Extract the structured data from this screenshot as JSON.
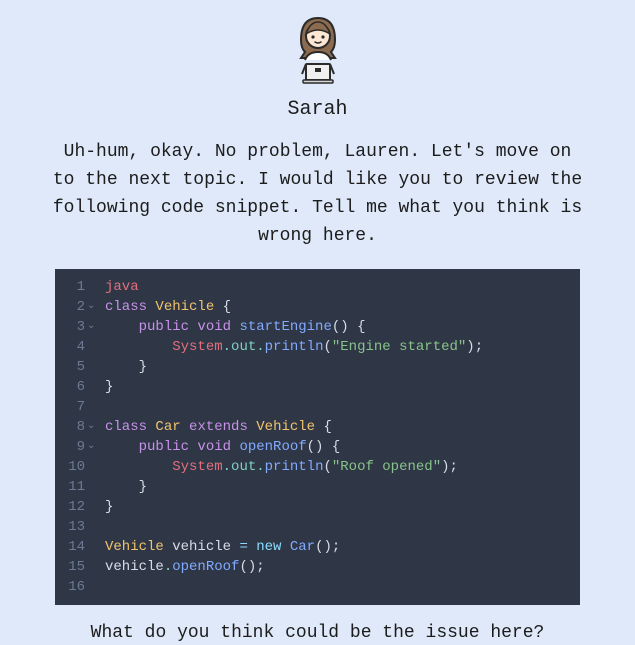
{
  "speaker": {
    "name": "Sarah"
  },
  "speech": "Uh-hum, okay. No problem, Lauren. Let's move on to the next topic. I would like you to review the following code snippet. Tell me what you think is wrong here.",
  "followup": "What do you think could be the issue here?",
  "code": {
    "language": "java",
    "lines": [
      {
        "n": 1,
        "fold": false,
        "tokens": [
          [
            "lang",
            "java"
          ]
        ]
      },
      {
        "n": 2,
        "fold": true,
        "tokens": [
          [
            "kw",
            "class "
          ],
          [
            "type",
            "Vehicle"
          ],
          [
            "punc",
            " {"
          ]
        ]
      },
      {
        "n": 3,
        "fold": true,
        "tokens": [
          [
            "plain",
            "    "
          ],
          [
            "kw",
            "public void "
          ],
          [
            "fn",
            "startEngine"
          ],
          [
            "punc",
            "() {"
          ]
        ]
      },
      {
        "n": 4,
        "fold": false,
        "tokens": [
          [
            "plain",
            "        "
          ],
          [
            "obj",
            "System"
          ],
          [
            "dot",
            ".out."
          ],
          [
            "fn",
            "println"
          ],
          [
            "punc",
            "("
          ],
          [
            "str",
            "\"Engine started\""
          ],
          [
            "punc",
            ");"
          ]
        ]
      },
      {
        "n": 5,
        "fold": false,
        "tokens": [
          [
            "plain",
            "    "
          ],
          [
            "punc",
            "}"
          ]
        ]
      },
      {
        "n": 6,
        "fold": false,
        "tokens": [
          [
            "punc",
            "}"
          ]
        ]
      },
      {
        "n": 7,
        "fold": false,
        "tokens": []
      },
      {
        "n": 8,
        "fold": true,
        "tokens": [
          [
            "kw",
            "class "
          ],
          [
            "type",
            "Car"
          ],
          [
            "kw",
            " extends "
          ],
          [
            "type",
            "Vehicle"
          ],
          [
            "punc",
            " {"
          ]
        ]
      },
      {
        "n": 9,
        "fold": true,
        "tokens": [
          [
            "plain",
            "    "
          ],
          [
            "kw",
            "public void "
          ],
          [
            "fn",
            "openRoof"
          ],
          [
            "punc",
            "() {"
          ]
        ]
      },
      {
        "n": 10,
        "fold": false,
        "tokens": [
          [
            "plain",
            "        "
          ],
          [
            "obj",
            "System"
          ],
          [
            "dot",
            ".out."
          ],
          [
            "fn",
            "println"
          ],
          [
            "punc",
            "("
          ],
          [
            "str",
            "\"Roof opened\""
          ],
          [
            "punc",
            ");"
          ]
        ]
      },
      {
        "n": 11,
        "fold": false,
        "tokens": [
          [
            "plain",
            "    "
          ],
          [
            "punc",
            "}"
          ]
        ]
      },
      {
        "n": 12,
        "fold": false,
        "tokens": [
          [
            "punc",
            "}"
          ]
        ]
      },
      {
        "n": 13,
        "fold": false,
        "tokens": []
      },
      {
        "n": 14,
        "fold": false,
        "tokens": [
          [
            "type",
            "Vehicle "
          ],
          [
            "plain",
            "vehicle "
          ],
          [
            "new",
            "= new "
          ],
          [
            "fn",
            "Car"
          ],
          [
            "punc",
            "();"
          ]
        ]
      },
      {
        "n": 15,
        "fold": false,
        "tokens": [
          [
            "plain",
            "vehicle"
          ],
          [
            "dot",
            "."
          ],
          [
            "fn",
            "openRoof"
          ],
          [
            "punc",
            "();"
          ]
        ]
      },
      {
        "n": 16,
        "fold": false,
        "tokens": []
      }
    ]
  }
}
